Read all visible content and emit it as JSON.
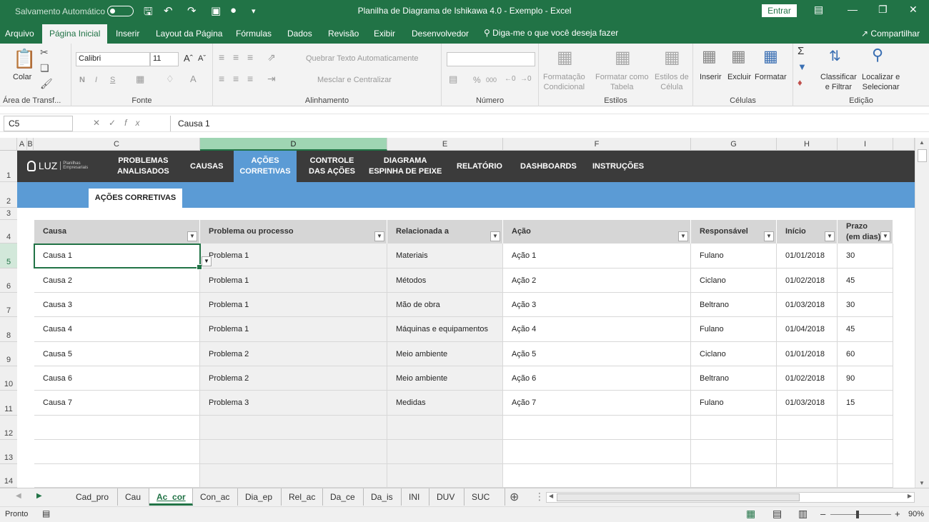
{
  "window": {
    "autosave_label": "Salvamento Automático",
    "title": "Planilha de Diagrama de Ishikawa 4.0 - Exemplo  -  Excel",
    "signin": "Entrar"
  },
  "ribbon_tabs": [
    "Arquivo",
    "Página Inicial",
    "Inserir",
    "Layout da Página",
    "Fórmulas",
    "Dados",
    "Revisão",
    "Exibir",
    "Desenvolvedor"
  ],
  "active_tab": "Página Inicial",
  "tellme": "Diga-me o que você deseja fazer",
  "share": "Compartilhar",
  "ribbon": {
    "clipboard": {
      "paste": "Colar",
      "label": "Área de Transf..."
    },
    "font": {
      "name": "Calibri",
      "size": "11",
      "bold": "N",
      "italic": "I",
      "underline": "S",
      "label": "Fonte"
    },
    "alignment": {
      "wrap": "Quebrar Texto Automaticamente",
      "merge": "Mesclar e Centralizar",
      "label": "Alinhamento"
    },
    "number": {
      "format": "",
      "percent": "%",
      "thousands": "000",
      "label": "Número"
    },
    "styles": {
      "cond1": "Formatação",
      "cond2": "Condicional",
      "table1": "Formatar como",
      "table2": "Tabela",
      "cell1": "Estilos de",
      "cell2": "Célula",
      "label": "Estilos"
    },
    "cells": {
      "insert": "Inserir",
      "delete": "Excluir",
      "format": "Formatar",
      "label": "Células"
    },
    "editing": {
      "sort1": "Classificar",
      "sort2": "e Filtrar",
      "find1": "Localizar e",
      "find2": "Selecionar",
      "label": "Edição"
    }
  },
  "formula": {
    "cell_ref": "C5",
    "value": "Causa 1"
  },
  "columns": [
    "A",
    "B",
    "C",
    "D",
    "E",
    "F",
    "G",
    "H",
    "I"
  ],
  "rows": [
    "1",
    "2",
    "3",
    "4",
    "5",
    "6",
    "7",
    "8",
    "9",
    "10",
    "11",
    "12",
    "13",
    "14"
  ],
  "nav": {
    "logo": "LUZ",
    "logo_sub": "Planilhas Empresariais",
    "items": [
      {
        "l1": "PROBLEMAS",
        "l2": "ANALISADOS"
      },
      {
        "l1": "CAUSAS",
        "l2": ""
      },
      {
        "l1": "AÇÕES",
        "l2": "CORRETIVAS"
      },
      {
        "l1": "CONTROLE",
        "l2": "DAS AÇÕES"
      },
      {
        "l1": "DIAGRAMA",
        "l2": "ESPINHA DE PEIXE"
      },
      {
        "l1": "RELATÓRIO",
        "l2": ""
      },
      {
        "l1": "DASHBOARDS",
        "l2": ""
      },
      {
        "l1": "INSTRUÇÕES",
        "l2": ""
      }
    ]
  },
  "page_tab": "AÇÕES CORRETIVAS",
  "table": {
    "headers": [
      "Causa",
      "Problema ou processo",
      "Relacionada a",
      "Ação",
      "Responsável",
      "Início",
      "Prazo"
    ],
    "prazo_sub": "(em dias)",
    "rows": [
      [
        "Causa 1",
        "Problema 1",
        "Materiais",
        "Ação 1",
        "Fulano",
        "01/01/2018",
        "30"
      ],
      [
        "Causa 2",
        "Problema 1",
        "Métodos",
        "Ação 2",
        "Ciclano",
        "01/02/2018",
        "45"
      ],
      [
        "Causa 3",
        "Problema 1",
        "Mão de obra",
        "Ação 3",
        "Beltrano",
        "01/03/2018",
        "30"
      ],
      [
        "Causa 4",
        "Problema 1",
        "Máquinas e equipamentos",
        "Ação 4",
        "Fulano",
        "01/04/2018",
        "45"
      ],
      [
        "Causa 5",
        "Problema 2",
        "Meio ambiente",
        "Ação 5",
        "Ciclano",
        "01/01/2018",
        "60"
      ],
      [
        "Causa 6",
        "Problema 2",
        "Meio ambiente",
        "Ação 6",
        "Beltrano",
        "01/02/2018",
        "90"
      ],
      [
        "Causa 7",
        "Problema 3",
        "Medidas",
        "Ação 7",
        "Fulano",
        "01/03/2018",
        "15"
      ]
    ]
  },
  "sheet_tabs": [
    "Cad_pro",
    "Cau",
    "Ac_cor",
    "Con_ac",
    "Dia_ep",
    "Rel_ac",
    "Da_ce",
    "Da_is",
    "INI",
    "DUV",
    "SUC ..."
  ],
  "active_sheet": "Ac_cor",
  "status": {
    "ready": "Pronto",
    "zoom": "90%"
  }
}
